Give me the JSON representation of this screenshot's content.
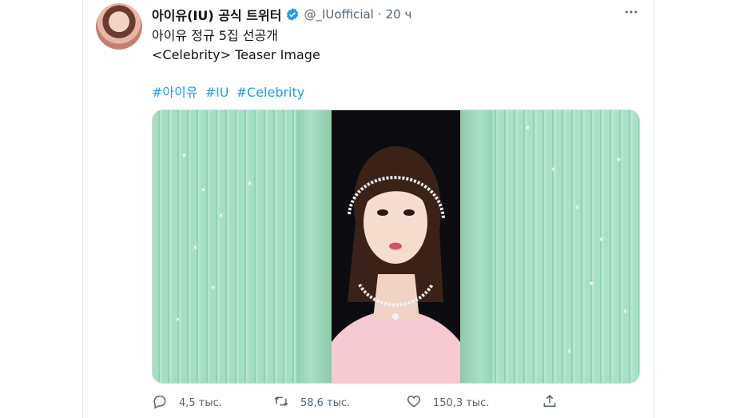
{
  "tweet": {
    "display_name": "아이유(IU) 공식 트위터",
    "handle": "@_IUofficial",
    "separator": "·",
    "time": "20 ч",
    "verified": true,
    "text_lines": [
      "아이유 정규 5집 선공개",
      "<Celebrity> Teaser Image"
    ],
    "hashtags": [
      "#아이유",
      "#IU",
      "#Celebrity"
    ],
    "media_description": "Teaser photo: woman in pink dress with jeweled headpiece peeking between mint-green ribbed doors"
  },
  "actions": {
    "reply_count": "4,5 тыс.",
    "retweet_count": "58,6 тыс.",
    "like_count": "150,3 тыс."
  },
  "colors": {
    "accent": "#1d9bf0",
    "text_primary": "#0f1419",
    "text_secondary": "#536471",
    "mint": "#9ad8bc"
  },
  "icons": [
    "more-icon",
    "verified-badge-icon",
    "reply-icon",
    "retweet-icon",
    "like-icon",
    "share-icon"
  ]
}
